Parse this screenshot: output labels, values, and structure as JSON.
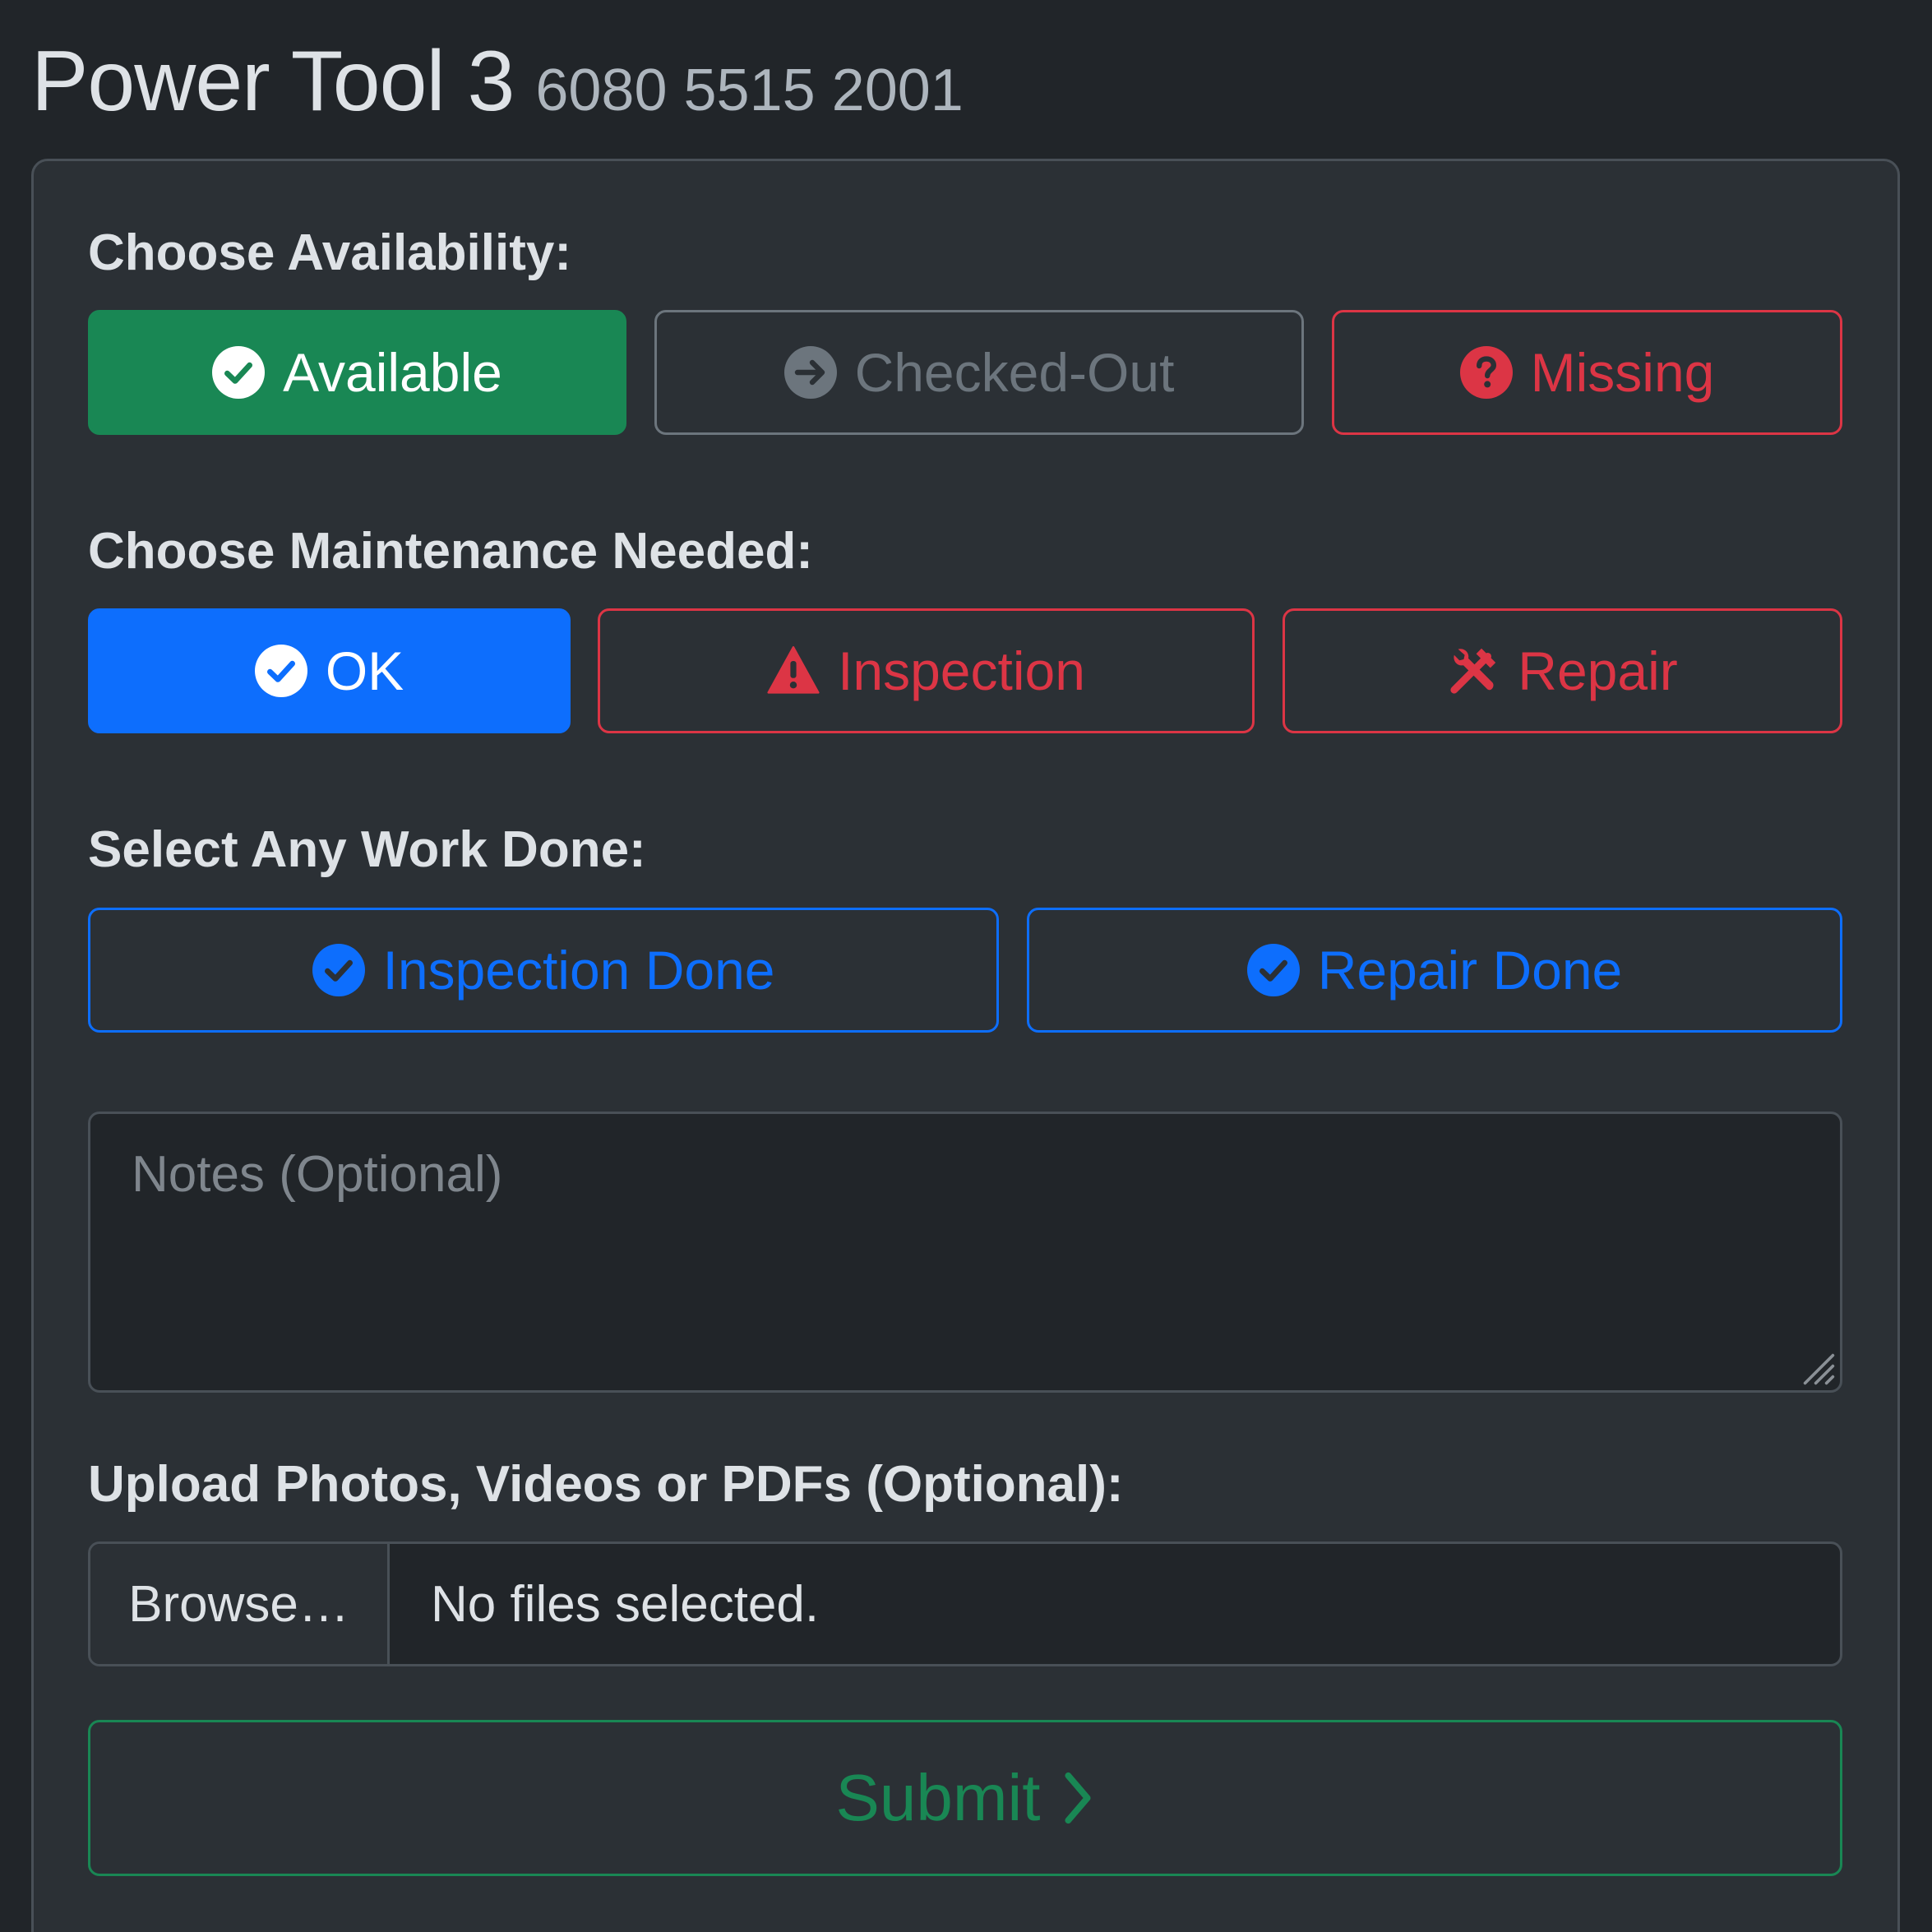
{
  "header": {
    "title": "Power Tool 3",
    "serial": "6080 5515 2001"
  },
  "availability": {
    "label": "Choose Availability:",
    "options": [
      {
        "label": "Available",
        "icon": "check-circle-icon",
        "state": "selected",
        "color": "#198754"
      },
      {
        "label": "Checked-Out",
        "icon": "arrow-right-circle-icon",
        "state": "unselected",
        "color": "#6c757d"
      },
      {
        "label": "Missing",
        "icon": "question-circle-icon",
        "state": "unselected",
        "color": "#dc3545"
      }
    ]
  },
  "maintenance": {
    "label": "Choose Maintenance Needed:",
    "options": [
      {
        "label": "OK",
        "icon": "check-circle-icon",
        "state": "selected",
        "color": "#0d6efd"
      },
      {
        "label": "Inspection",
        "icon": "warning-triangle-icon",
        "state": "unselected",
        "color": "#dc3545"
      },
      {
        "label": "Repair",
        "icon": "tools-icon",
        "state": "unselected",
        "color": "#dc3545"
      }
    ]
  },
  "work_done": {
    "label": "Select Any Work Done:",
    "options": [
      {
        "label": "Inspection Done",
        "icon": "check-circle-icon",
        "state": "unselected",
        "color": "#0d6efd"
      },
      {
        "label": "Repair Done",
        "icon": "check-circle-icon",
        "state": "unselected",
        "color": "#0d6efd"
      }
    ]
  },
  "notes": {
    "placeholder": "Notes (Optional)",
    "value": ""
  },
  "upload": {
    "label": "Upload Photos, Videos or PDFs (Optional):",
    "browse_label": "Browse…",
    "status": "No files selected."
  },
  "submit": {
    "label": "Submit",
    "icon": "chevron-right-icon",
    "color": "#198754"
  },
  "theme": {
    "background": "#212529",
    "card": "#2b3035",
    "border": "#495057"
  }
}
